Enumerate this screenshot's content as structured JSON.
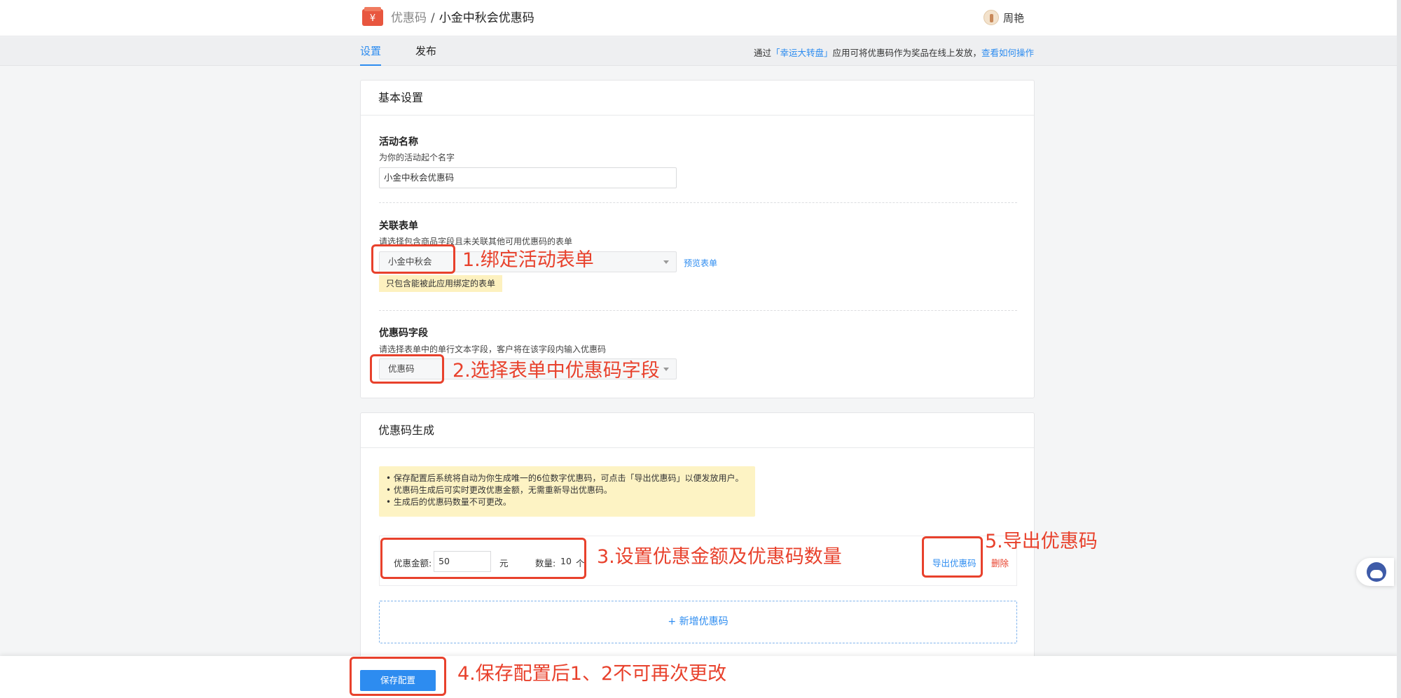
{
  "header": {
    "breadcrumb_root": "优惠码",
    "breadcrumb_sep": "/",
    "breadcrumb_current": "小金中秋会优惠码",
    "user_name": "周艳"
  },
  "subnav": {
    "tabs": [
      {
        "label": "设置"
      },
      {
        "label": "发布"
      }
    ],
    "tip_prefix": "通过",
    "tip_app_link": "「幸运大转盘」",
    "tip_middle": "应用可将优惠码作为奖品在线上发放，",
    "tip_howto_link": "查看如何操作"
  },
  "basic": {
    "title": "基本设置",
    "activity_name_label": "活动名称",
    "activity_name_hint": "为你的活动起个名字",
    "activity_name_value": "小金中秋会优惠码",
    "form_label": "关联表单",
    "form_hint": "请选择包含商品字段且未关联其他可用优惠码的表单",
    "form_value": "小金中秋会",
    "preview_link": "预览表单",
    "form_note": "只包含能被此应用绑定的表单",
    "field_label": "优惠码字段",
    "field_hint": "请选择表单中的单行文本字段，客户将在该字段内输入优惠码",
    "field_value": "优惠码"
  },
  "generate": {
    "title": "优惠码生成",
    "notices": [
      "保存配置后系统将自动为你生成唯一的6位数字优惠码，可点击「导出优惠码」以便发放用户。",
      "优惠码生成后可实时更改优惠金额，无需重新导出优惠码。",
      "生成后的优惠码数量不可更改。"
    ],
    "amount_label": "优惠金额:",
    "amount_value": "50",
    "amount_unit": "元",
    "count_label": "数量:",
    "count_value": "10",
    "count_unit": "个",
    "export_label": "导出优惠码",
    "delete_label": "删除",
    "add_label": "+ 新增优惠码"
  },
  "footer": {
    "save_label": "保存配置"
  },
  "annotations": [
    "1.绑定活动表单",
    "2.选择表单中优惠码字段",
    "3.设置优惠金额及优惠码数量",
    "4.保存配置后1、2不可再次更改",
    "5.导出优惠码"
  ],
  "colors": {
    "accent": "#2d8cf0",
    "annotation": "#e8412c",
    "notice_bg": "#fdf3c4"
  }
}
